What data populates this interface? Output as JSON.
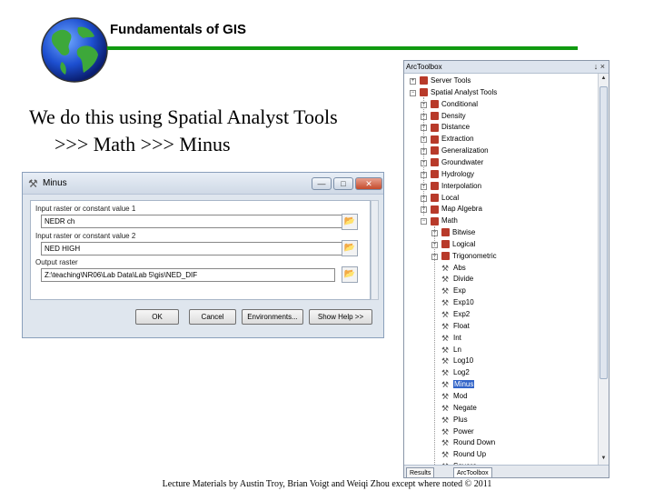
{
  "header": {
    "title": "Fundamentals of GIS"
  },
  "body": {
    "line1": "We do this using Spatial Analyst Tools",
    "line2": ">>> Math >>> Minus"
  },
  "dialog": {
    "title": "Minus",
    "input1_label": "Input raster or constant value 1",
    "input1_value": "NEDR ch",
    "input2_label": "Input raster or constant value 2",
    "input2_value": "NED HIGH",
    "output_label": "Output raster",
    "output_value": "Z:\\teaching\\NR06\\Lab Data\\Lab 5\\gis\\NED_DIF",
    "buttons": {
      "ok": "OK",
      "cancel": "Cancel",
      "environments": "Environments...",
      "show_help": "Show Help >>"
    }
  },
  "toolbox": {
    "title": "ArcToolbox",
    "controls": "↓ ×",
    "items": [
      {
        "label": "Server Tools",
        "kind": "toolbox",
        "exp": "+"
      },
      {
        "label": "Spatial Analyst Tools",
        "kind": "toolbox",
        "exp": "−"
      },
      {
        "label": "Conditional",
        "kind": "toolset",
        "exp": "+"
      },
      {
        "label": "Density",
        "kind": "toolset",
        "exp": "+"
      },
      {
        "label": "Distance",
        "kind": "toolset",
        "exp": "+"
      },
      {
        "label": "Extraction",
        "kind": "toolset",
        "exp": "+"
      },
      {
        "label": "Generalization",
        "kind": "toolset",
        "exp": "+"
      },
      {
        "label": "Groundwater",
        "kind": "toolset",
        "exp": "+"
      },
      {
        "label": "Hydrology",
        "kind": "toolset",
        "exp": "+"
      },
      {
        "label": "Interpolation",
        "kind": "toolset",
        "exp": "+"
      },
      {
        "label": "Local",
        "kind": "toolset",
        "exp": "+"
      },
      {
        "label": "Map Algebra",
        "kind": "toolset",
        "exp": "+"
      },
      {
        "label": "Math",
        "kind": "toolset",
        "exp": "−"
      },
      {
        "label": "Bitwise",
        "kind": "toolset",
        "exp": "+"
      },
      {
        "label": "Logical",
        "kind": "toolset",
        "exp": "+"
      },
      {
        "label": "Trigonometric",
        "kind": "toolset",
        "exp": "+"
      },
      {
        "label": "Abs",
        "kind": "tool"
      },
      {
        "label": "Divide",
        "kind": "tool"
      },
      {
        "label": "Exp",
        "kind": "tool"
      },
      {
        "label": "Exp10",
        "kind": "tool"
      },
      {
        "label": "Exp2",
        "kind": "tool"
      },
      {
        "label": "Float",
        "kind": "tool"
      },
      {
        "label": "Int",
        "kind": "tool"
      },
      {
        "label": "Ln",
        "kind": "tool"
      },
      {
        "label": "Log10",
        "kind": "tool"
      },
      {
        "label": "Log2",
        "kind": "tool"
      },
      {
        "label": "Minus",
        "kind": "tool",
        "selected": true
      },
      {
        "label": "Mod",
        "kind": "tool"
      },
      {
        "label": "Negate",
        "kind": "tool"
      },
      {
        "label": "Plus",
        "kind": "tool"
      },
      {
        "label": "Power",
        "kind": "tool"
      },
      {
        "label": "Round Down",
        "kind": "tool"
      },
      {
        "label": "Round Up",
        "kind": "tool"
      },
      {
        "label": "Square",
        "kind": "tool"
      }
    ],
    "tabs": {
      "results": "Results",
      "arctoolbox": "ArcToolbox"
    }
  },
  "footer": {
    "note": "Lecture Materials by Austin Troy, Brian Voigt and Weiqi Zhou except where noted © 2011"
  },
  "colors": {
    "accent_rule": "#109a10",
    "selection": "#3264c8",
    "toolbox_icon": "#b83a2a"
  }
}
